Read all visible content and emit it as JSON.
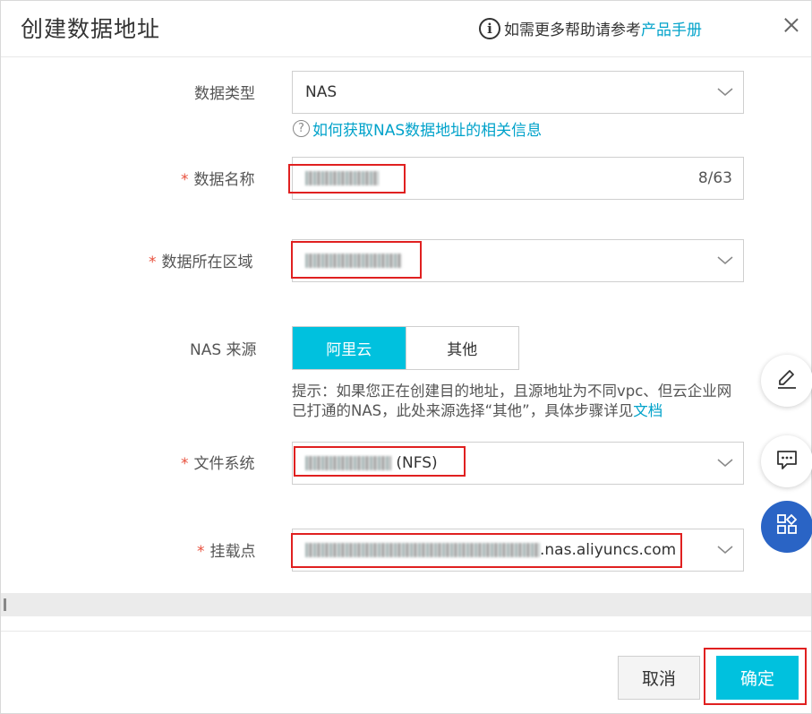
{
  "dialog": {
    "title": "创建数据地址",
    "help_prefix": "如需更多帮助请参考",
    "help_link": "产品手册"
  },
  "form": {
    "data_type": {
      "label": "数据类型",
      "value": "NAS"
    },
    "nas_hint": "如何获取NAS数据地址的相关信息",
    "data_name": {
      "label": "数据名称",
      "required_mark": "*",
      "counter": "8/63"
    },
    "region": {
      "label": "数据所在区域",
      "required_mark": "*"
    },
    "nas_source": {
      "label": "NAS 来源",
      "options": [
        "阿里云",
        "其他"
      ],
      "selected": "阿里云"
    },
    "tip": {
      "text": "提示：如果您正在创建目的地址，且源地址为不同vpc、但云企业网已打通的NAS，此处来源选择“其他”，具体步骤详见",
      "link": "文档"
    },
    "file_system": {
      "label": "文件系统",
      "required_mark": "*",
      "suffix": "(NFS)"
    },
    "mount_point": {
      "label": "挂载点",
      "required_mark": "*",
      "suffix": ".nas.aliyuncs.com"
    }
  },
  "footer": {
    "cancel_label": "取消",
    "ok_label": "确定"
  },
  "floating_buttons": [
    "edit-icon",
    "chat-icon",
    "apps-icon"
  ],
  "colors": {
    "accent": "#00c1de",
    "link": "#00a2ca",
    "required": "#e84f3c",
    "highlight_box": "#e02020",
    "float_blue": "#2a64c5"
  }
}
